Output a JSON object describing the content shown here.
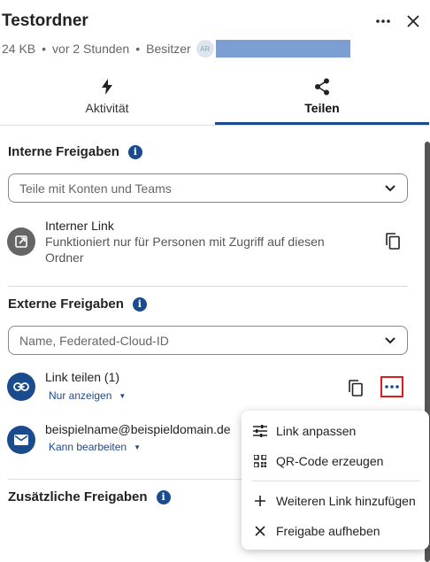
{
  "header": {
    "title": "Testordner",
    "size": "24 KB",
    "separator": "•",
    "modified": "vor 2 Stunden",
    "owner_label": "Besitzer",
    "owner_avatar_initials": "AR",
    "more_icon": "more-horizontal-icon",
    "close_icon": "close-icon"
  },
  "tabs": [
    {
      "label": "Aktivität",
      "icon": "lightning-icon",
      "active": false
    },
    {
      "label": "Teilen",
      "icon": "share-icon",
      "active": true
    }
  ],
  "internal": {
    "heading": "Interne Freigaben",
    "search_placeholder": "Teile mit Konten und Teams",
    "link_title": "Interner Link",
    "link_desc_1": "Funktioniert nur für Personen mit Zugriff auf diesen",
    "link_desc_2": "Ordner"
  },
  "external": {
    "heading": "Externe Freigaben",
    "search_placeholder": "Name, Federated-Cloud-ID",
    "share_link_title": "Link teilen (1)",
    "share_link_perm": "Nur anzeigen",
    "email_title": "beispielname@beispieldomain.de",
    "email_perm": "Kann bearbeiten"
  },
  "additional": {
    "heading": "Zusätzliche Freigaben"
  },
  "menu": {
    "items": [
      {
        "label": "Link anpassen",
        "icon": "tune-icon"
      },
      {
        "label": "QR-Code erzeugen",
        "icon": "qr-code-icon"
      },
      {
        "label": "Weiteren Link hinzufügen",
        "icon": "plus-icon"
      },
      {
        "label": "Freigabe aufheben",
        "icon": "close-icon"
      }
    ]
  },
  "colors": {
    "accent": "#1b4b8f",
    "highlight_border": "#e01b1b"
  }
}
